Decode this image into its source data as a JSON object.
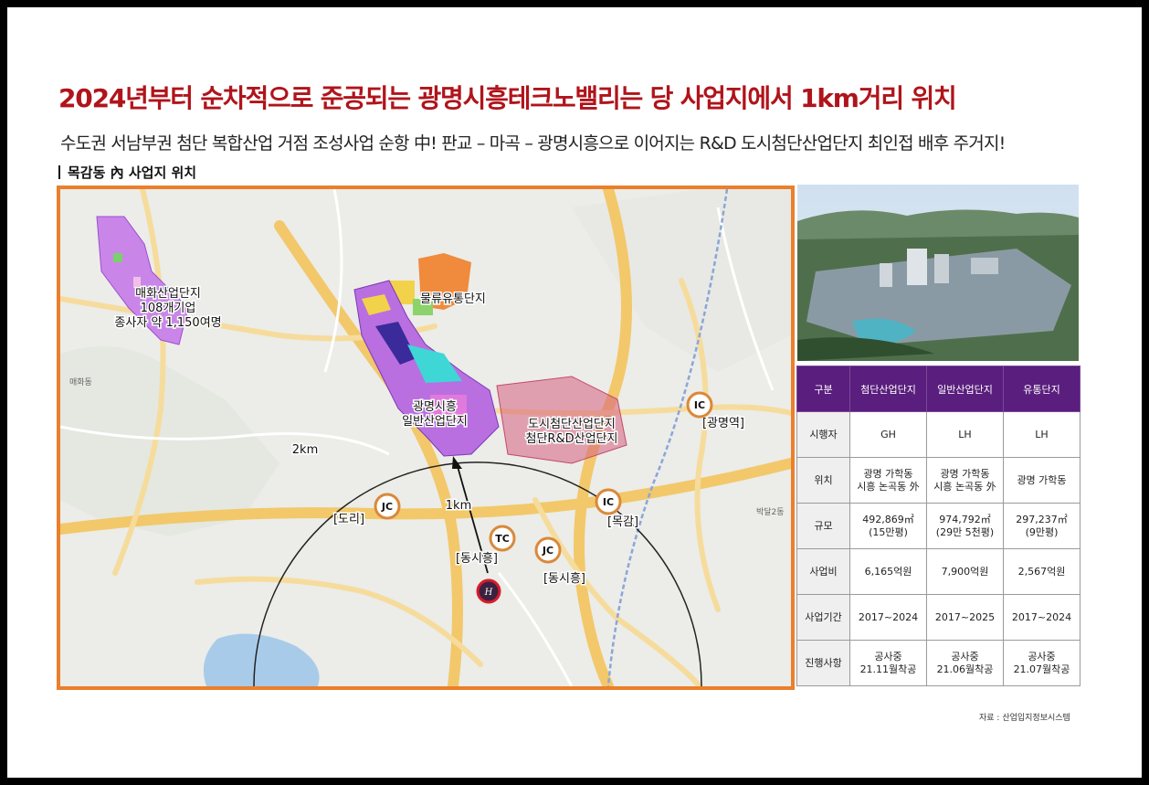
{
  "headline": "2024년부터 순차적으로 준공되는 광명시흥테크노밸리는 당 사업지에서 1km거리 위치",
  "subtitle": "수도권 서남부권 첨단 복합산업 거점 조성사업 순항 中! 판교 – 마곡 – 광명시흥으로 이어지는 R&D 도시첨단산업단지 최인접 배후 주거지!",
  "section_label": "목감동 內 사업지 위치",
  "map": {
    "labels": {
      "maehwa_line1": "매화산업단지",
      "maehwa_line2": "108개기업",
      "maehwa_line3": "종사자 약 1,150여명",
      "logistics": "물류유통단지",
      "general_line1": "광명시흥",
      "general_line2": "일반산업단지",
      "urban_line1": "도시첨단산업단지",
      "urban_line2": "첨단R&D산업단지",
      "radius_2km": "2km",
      "radius_1km": "1km",
      "gwangmyeong_station": "[광명역]",
      "dori": "[도리]",
      "mokgam": "[목감]",
      "dongsiheung_tc": "[동시흥]",
      "dongsiheung_jc": "[동시흥]",
      "maehwa_dong": "매화동",
      "bakdal": "박달2동"
    },
    "markers": {
      "ic_gwangmyeong": "IC",
      "jc_dori": "JC",
      "ic_mokgam": "IC",
      "tc_dongsiheung": "TC",
      "jc_dongsiheung": "JC"
    },
    "colors": {
      "frame": "#ea7f2c",
      "marker_ring": "#d9893a",
      "site_ring": "#d81b2b",
      "industrial": "#b96fe0"
    }
  },
  "table": {
    "headers": [
      "구분",
      "첨단산업단지",
      "일반산업단지",
      "유통단지"
    ],
    "rows": [
      {
        "label": "시행자",
        "c1": "GH",
        "c2": "LH",
        "c3": "LH"
      },
      {
        "label": "위치",
        "c1": "광명 가학동\n시흥 논곡동 外",
        "c2": "광명 가학동\n시흥 논곡동 外",
        "c3": "광명 가학동"
      },
      {
        "label": "규모",
        "c1": "492,869㎡\n(15만평)",
        "c2": "974,792㎡\n(29만 5천평)",
        "c3": "297,237㎡\n(9만평)"
      },
      {
        "label": "사업비",
        "c1": "6,165억원",
        "c2": "7,900억원",
        "c3": "2,567억원"
      },
      {
        "label": "사업기간",
        "c1": "2017~2024",
        "c2": "2017~2025",
        "c3": "2017~2024"
      },
      {
        "label": "진행사항",
        "c1": "공사중\n21.11월착공",
        "c2": "공사중\n21.06월착공",
        "c3": "공사중\n21.07월착공"
      }
    ],
    "header_color": "#5a1e7e"
  },
  "source": "자료 : 산업입지정보시스템"
}
